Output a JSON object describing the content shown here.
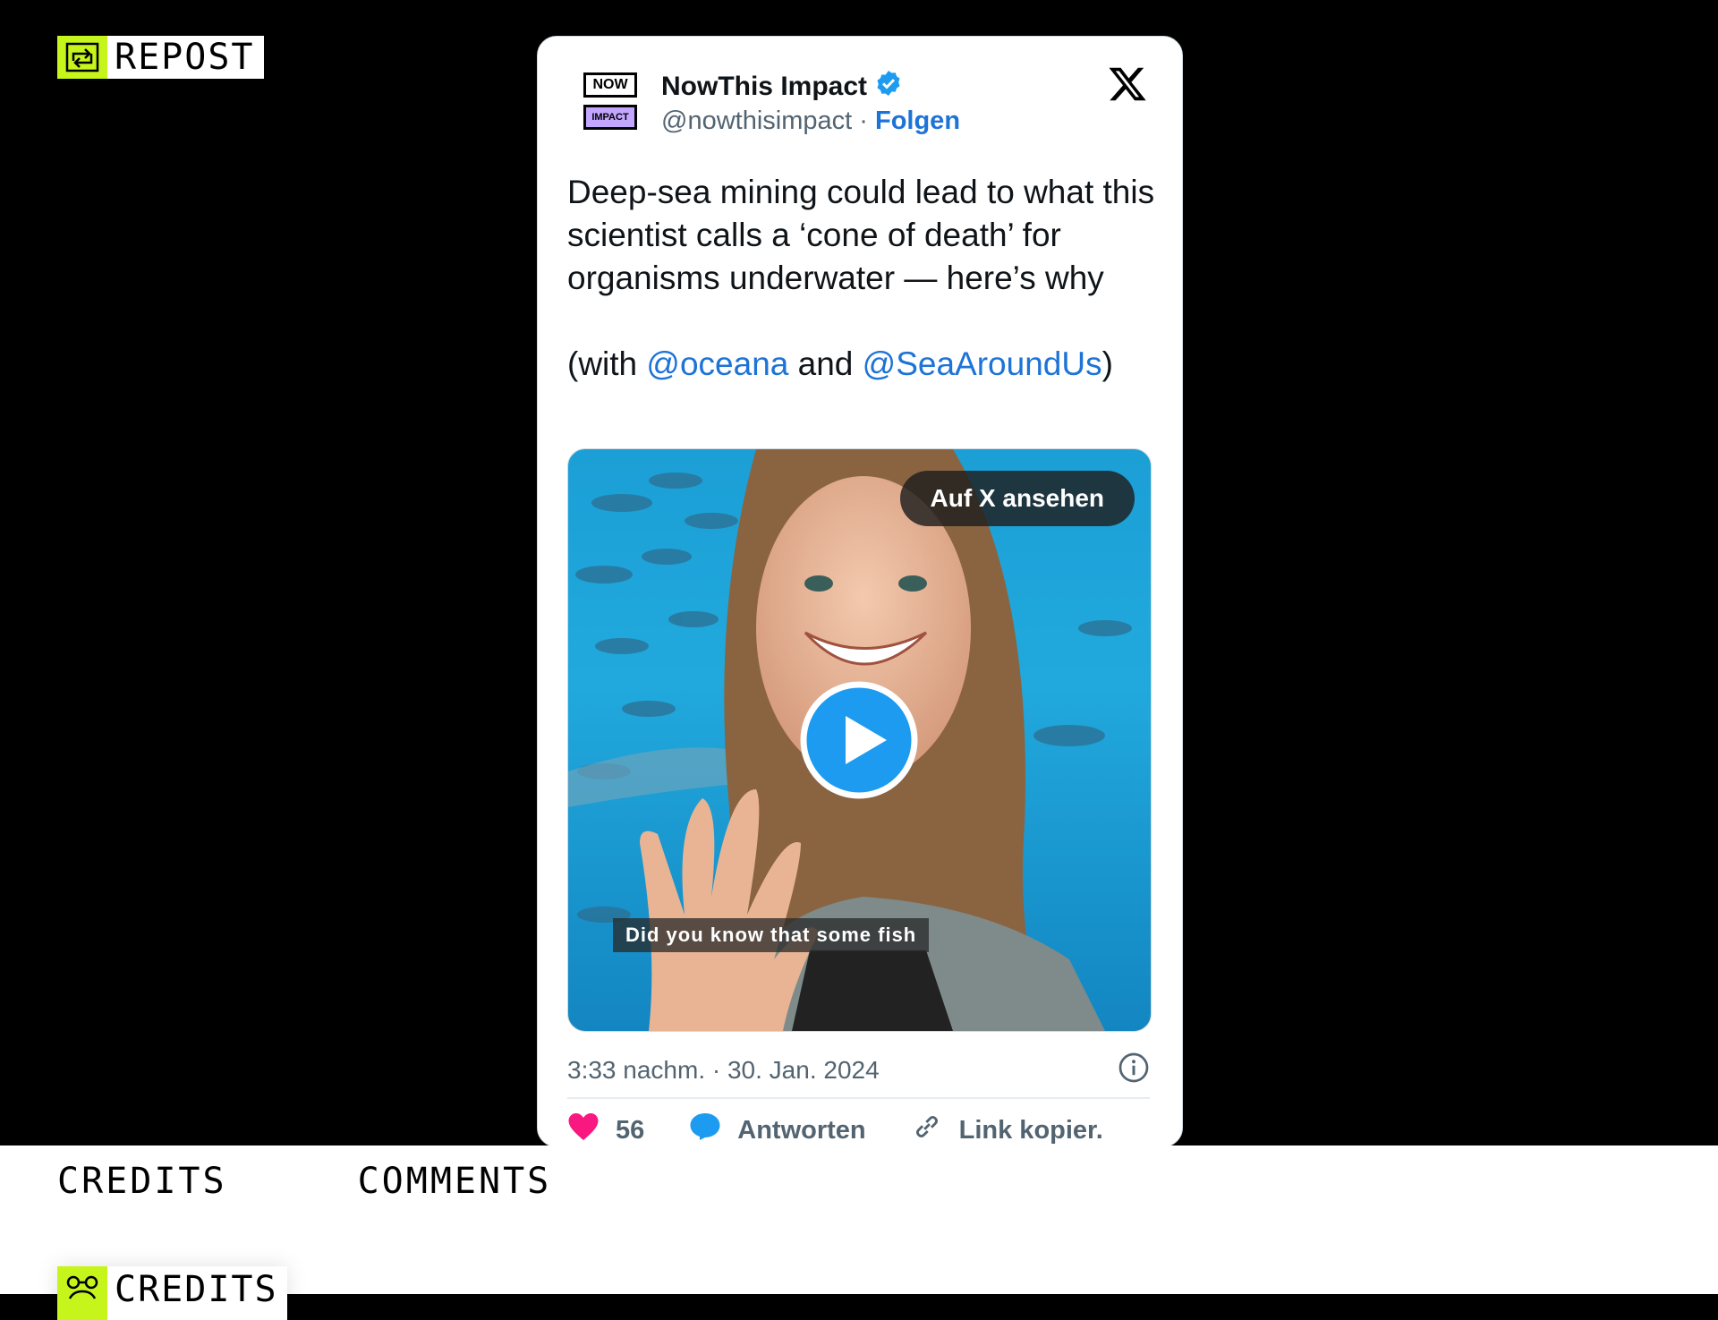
{
  "repost_tag": {
    "label": "REPOST",
    "icon": "repost-icon"
  },
  "tweet": {
    "account": {
      "logo_top": "NOW",
      "logo_bottom": "IMPACT",
      "name": "NowThis Impact",
      "verified": true,
      "handle": "@nowthisimpact",
      "separator": "·",
      "follow_label": "Folgen"
    },
    "text": {
      "line1": "Deep-sea mining could lead to what this scientist calls a ‘cone of death’ for organisms underwater — here’s why",
      "with_prefix": "(with ",
      "mention1": "@oceana",
      "and": " and ",
      "mention2": "@SeaAroundUs",
      "suffix": ")"
    },
    "media": {
      "watch_label": "Auf X ansehen",
      "caption": "Did you know that some fish"
    },
    "timestamp": "3:33 nachm. · 30. Jan. 2024",
    "actions": {
      "likes": "56",
      "reply_label": "Antworten",
      "copy_label": "Link kopier."
    },
    "colors": {
      "accent": "#1d73d6",
      "like": "#f91880",
      "verified": "#1d9bf0"
    }
  },
  "bottom": {
    "tabs": [
      "CREDITS",
      "COMMENTS"
    ],
    "credits_tag": "CREDITS"
  },
  "brand_color": "#c6f51b"
}
